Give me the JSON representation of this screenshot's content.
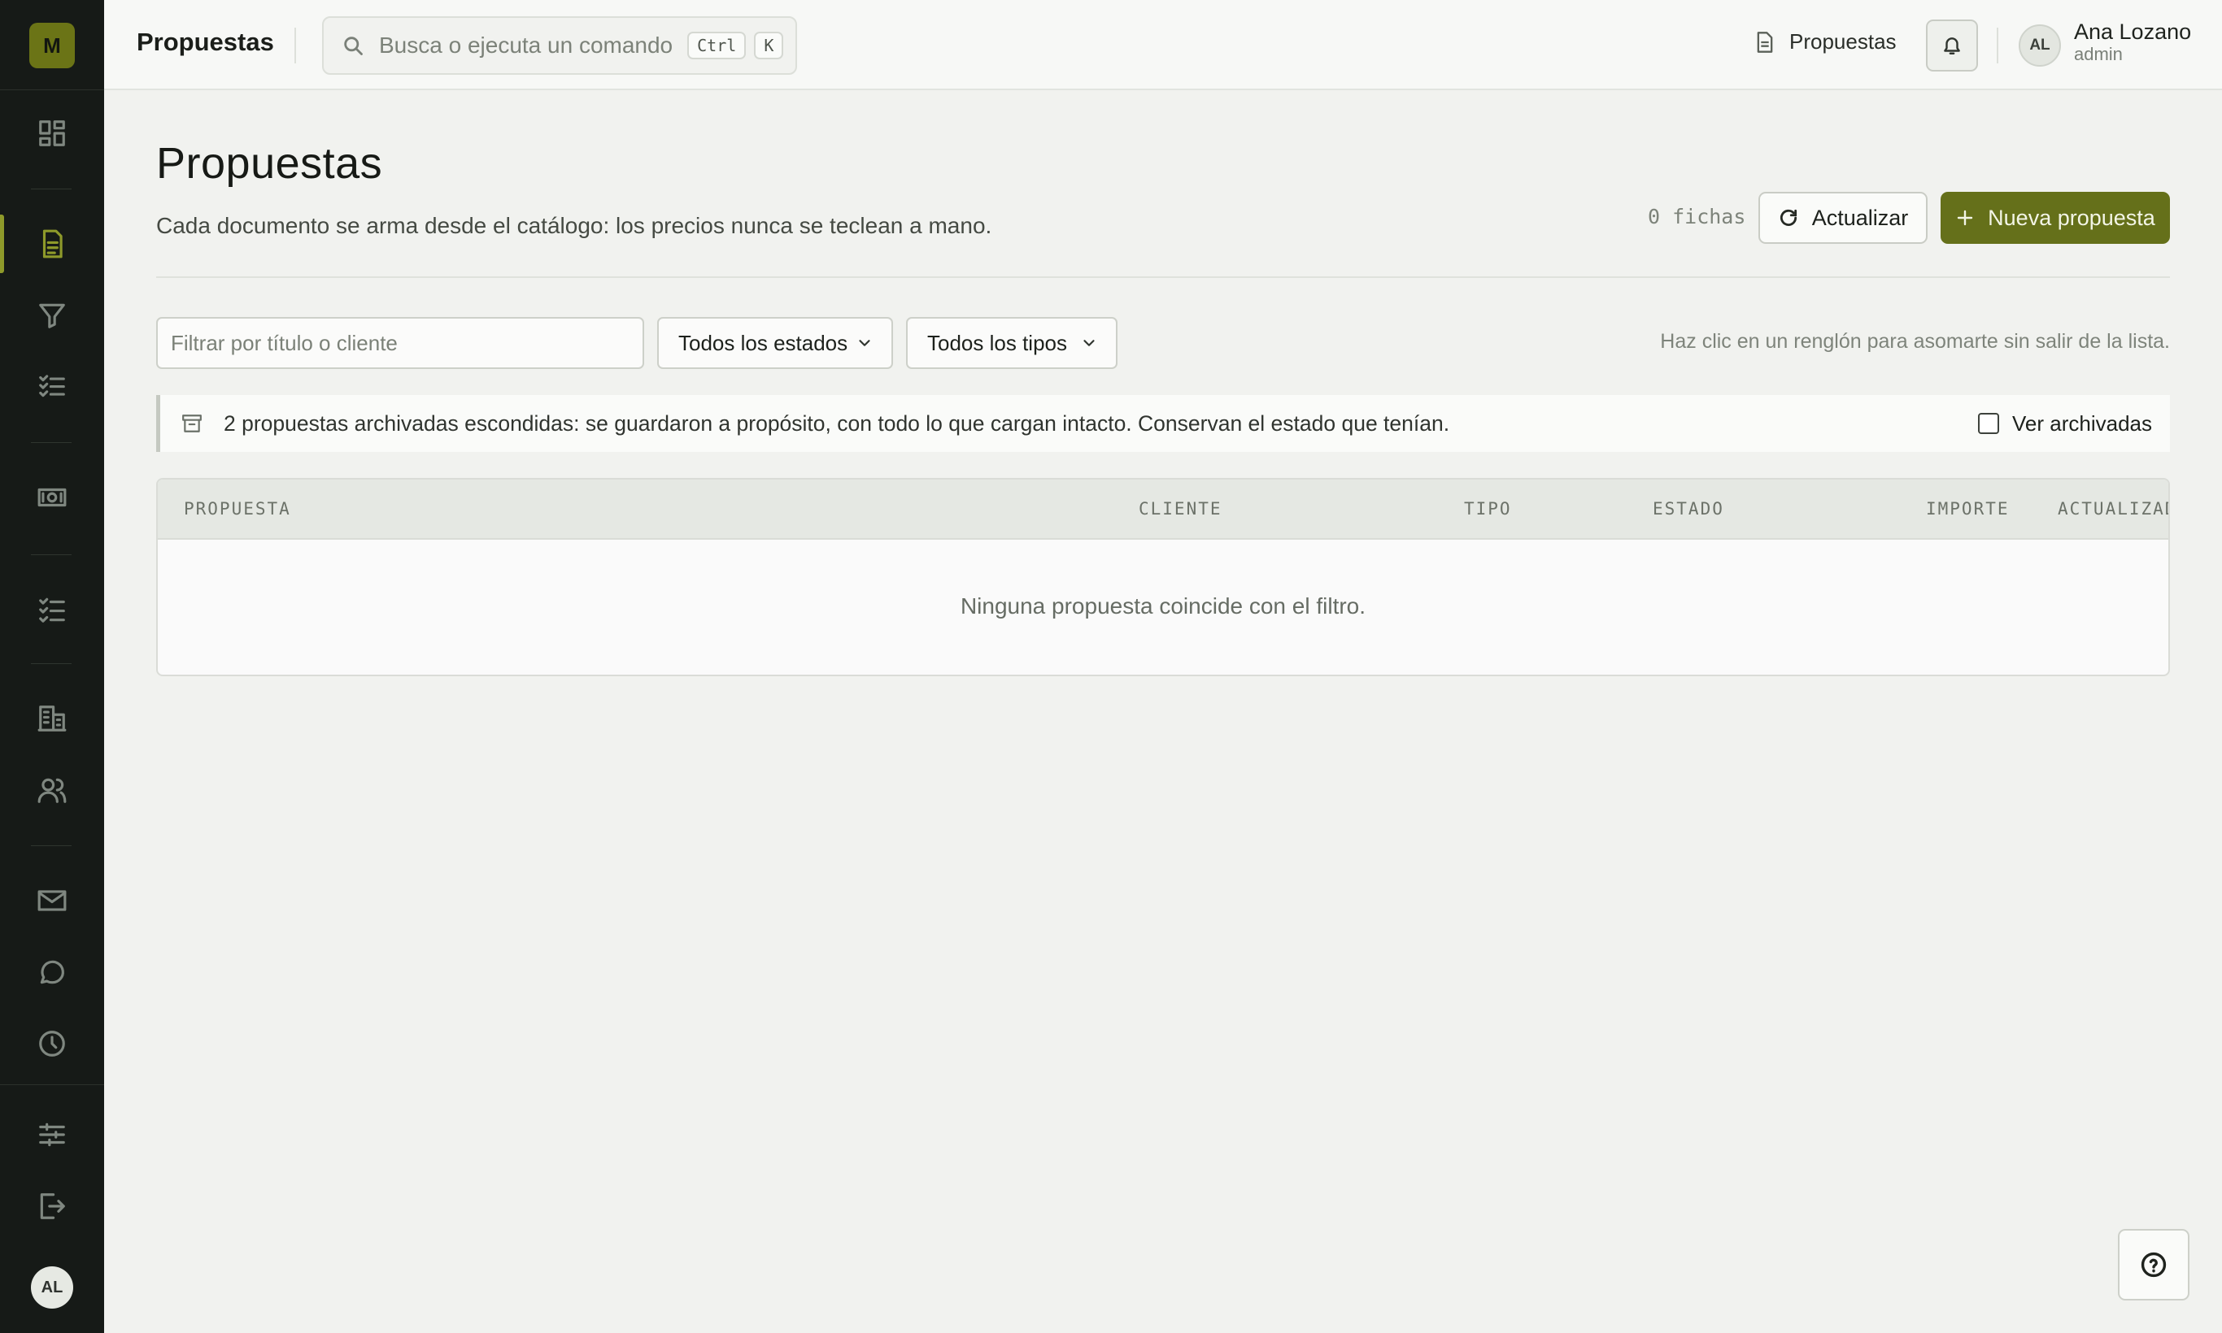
{
  "app": {
    "logo_letter": "M"
  },
  "topbar": {
    "title": "Propuestas",
    "search_placeholder": "Busca o ejecuta un comando",
    "kbd_ctrl": "Ctrl",
    "kbd_k": "K",
    "breadcrumb": "Propuestas",
    "user_initials": "AL",
    "user_name": "Ana Lozano",
    "user_role": "admin"
  },
  "sidebar": {
    "items": [
      {
        "icon": "dashboard-icon",
        "active": false
      },
      {
        "icon": "document-icon",
        "active": true
      },
      {
        "icon": "filter-icon",
        "active": false
      },
      {
        "icon": "checklist-icon",
        "active": false
      },
      {
        "icon": "money-icon",
        "active": false
      },
      {
        "icon": "task-list-icon",
        "active": false
      },
      {
        "icon": "building-icon",
        "active": false
      },
      {
        "icon": "users-icon",
        "active": false
      },
      {
        "icon": "mail-icon",
        "active": false
      },
      {
        "icon": "chat-icon",
        "active": false
      },
      {
        "icon": "clock-icon",
        "active": false
      },
      {
        "icon": "sliders-icon",
        "active": false
      },
      {
        "icon": "logout-icon",
        "active": false
      }
    ],
    "avatar_initials": "AL"
  },
  "page": {
    "title": "Propuestas",
    "subtitle": "Cada documento se arma desde el catálogo: los precios nunca se teclean a mano.",
    "count": "0 fichas",
    "refresh_label": "Actualizar",
    "new_label": "Nueva propuesta"
  },
  "filters": {
    "search_placeholder": "Filtrar por título o cliente",
    "status_selected": "Todos los estados",
    "type_selected": "Todos los tipos",
    "hint": "Haz clic en un renglón para asomarte sin salir de la lista."
  },
  "banner": {
    "text": "2 propuestas archivadas escondidas: se guardaron a propósito, con todo lo que cargan intacto. Conservan el estado que tenían.",
    "checkbox_label": "Ver archivadas",
    "checked": false
  },
  "table": {
    "columns": [
      "PROPUESTA",
      "CLIENTE",
      "TIPO",
      "ESTADO",
      "IMPORTE",
      "ACTUALIZAD"
    ],
    "empty_message": "Ninguna propuesta coincide con el filtro."
  },
  "colors": {
    "accent": "#65701a",
    "sidebar_bg": "#161a17",
    "page_bg": "#f1f2ef"
  }
}
